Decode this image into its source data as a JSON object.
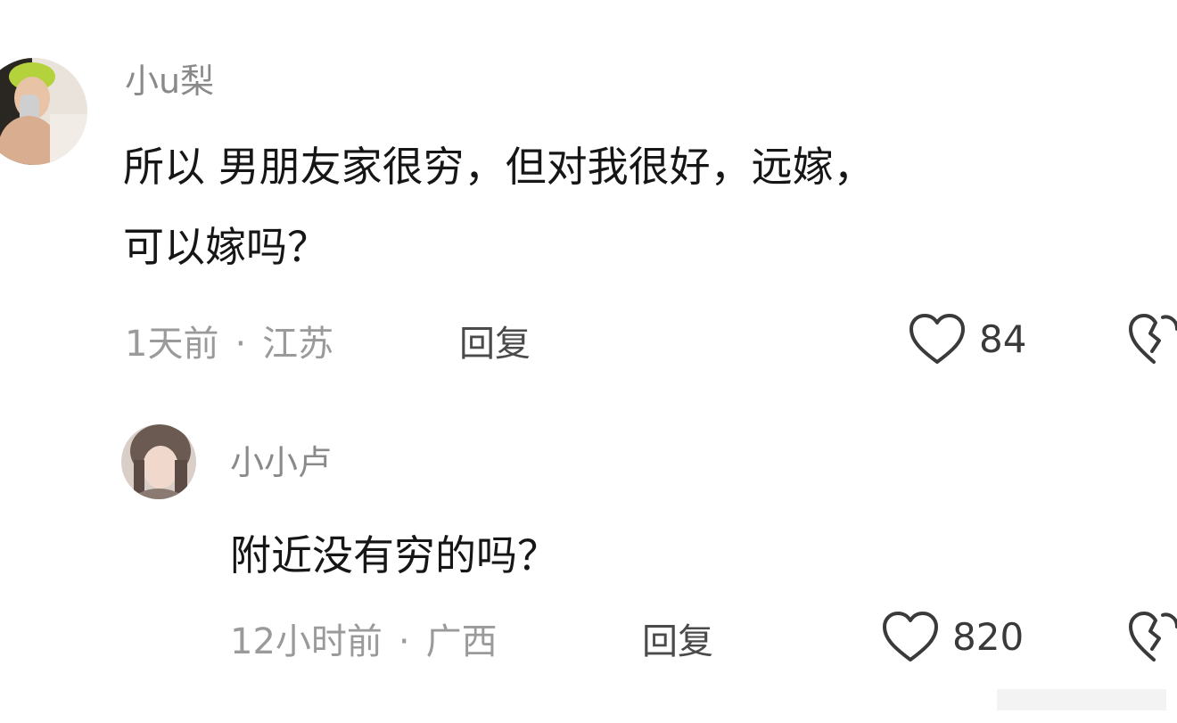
{
  "comments": [
    {
      "username": "小u梨",
      "content": "所以 男朋友家很穷，但对我很好，远嫁，\n可以嫁吗？",
      "time": "1天前",
      "separator": "·",
      "location": "江苏",
      "reply_label": "回复",
      "likes": "84"
    },
    {
      "username": "小小卢",
      "content": "附近没有穷的吗？",
      "time": "12小时前",
      "separator": "·",
      "location": "广西",
      "reply_label": "回复",
      "likes": "820"
    }
  ],
  "colors": {
    "text": "#161616",
    "username": "#8a8a8a",
    "meta": "#9a9a9a",
    "icon": "#3a3a3a"
  }
}
